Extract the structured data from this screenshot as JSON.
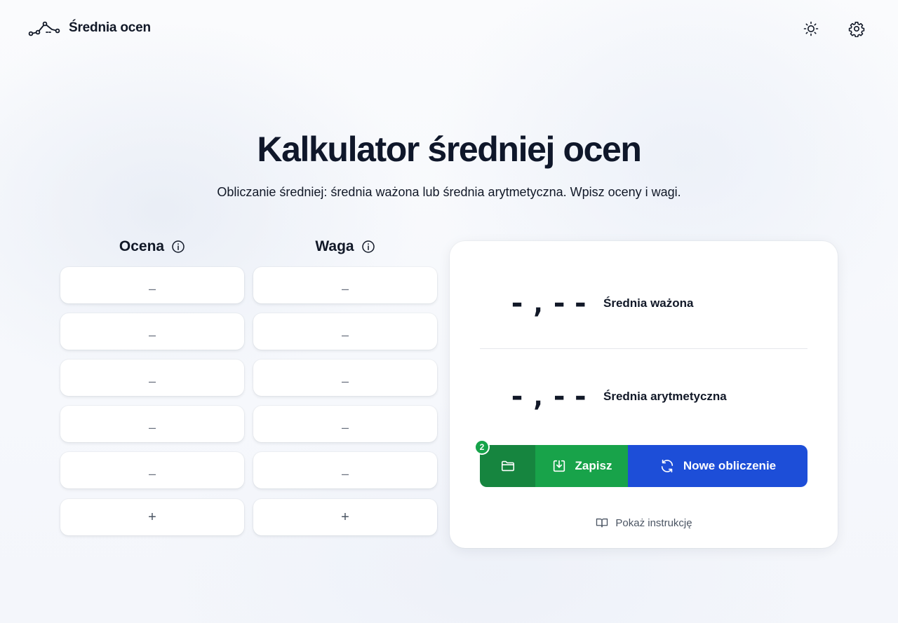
{
  "header": {
    "brand_name": "Średnia ocen",
    "logo_icon": "trend-line-icon",
    "theme_icon": "sun-icon",
    "settings_icon": "gear-icon"
  },
  "hero": {
    "title": "Kalkulator średniej ocen",
    "subtitle": "Obliczanie średniej: średnia ważona lub średnia arytmetyczna. Wpisz oceny i wagi."
  },
  "columns": {
    "ocena": {
      "label": "Ocena",
      "info_icon": "info-icon"
    },
    "waga": {
      "label": "Waga",
      "info_icon": "info-icon"
    }
  },
  "rows": [
    {
      "grade": "–",
      "weight": "–"
    },
    {
      "grade": "–",
      "weight": "–"
    },
    {
      "grade": "–",
      "weight": "–"
    },
    {
      "grade": "–",
      "weight": "–"
    },
    {
      "grade": "–",
      "weight": "–"
    }
  ],
  "add_label": "+",
  "results": {
    "weighted": {
      "value": "-,--",
      "label": "Średnia ważona"
    },
    "arithmetic": {
      "value": "-,--",
      "label": "Średnia arytmetyczna"
    }
  },
  "actions": {
    "folder_badge": "2",
    "folder_icon": "folder-icon",
    "save_label": "Zapisz",
    "save_icon": "download-icon",
    "new_label": "Nowe obliczenie",
    "new_icon": "refresh-icon"
  },
  "instructions": {
    "label": "Pokaż instrukcję",
    "icon": "book-icon"
  },
  "colors": {
    "folder_button": "#16853f",
    "save_button": "#18a34a",
    "new_button": "#1d4ed8",
    "text": "#111827"
  }
}
